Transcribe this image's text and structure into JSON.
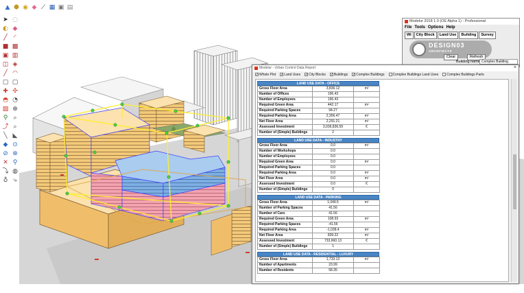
{
  "toolbar": {
    "icons": [
      "select-icon",
      "component-icon",
      "paint-bucket-icon",
      "eraser-icon",
      "tape-measure-icon",
      "section-icon",
      "warehouse-icon",
      "extension-icon"
    ]
  },
  "palette": {
    "icons": [
      "select-arrow-icon",
      "rotate-icon",
      "paint-icon",
      "eraser-icon",
      "pencil-line-icon",
      "arc-icon",
      "rectangle-icon",
      "shape-icon",
      "push-pull-icon",
      "offset-icon",
      "move-icon",
      "follow-me-icon",
      "scale-icon",
      "orbit-icon",
      "pan-icon",
      "zoom-icon",
      "walk-icon",
      "look-around-icon",
      "position-camera-icon",
      "section-plane-icon",
      "text-icon",
      "dimension-icon",
      "protractor-icon",
      "axes-icon",
      "tape-icon",
      "3d-text-icon",
      "paint-sample-icon",
      "eraser-alt-icon"
    ]
  },
  "plugin_window": {
    "title": "Modelur 2018 1.0 (OE Alpha 1) - Professional",
    "menu": [
      "File",
      "Tools",
      "Options",
      "Help"
    ],
    "tabs": [
      "Wi",
      "City Block",
      "Land Use",
      "Building",
      "Survey"
    ],
    "active_tab": "Building",
    "logo_text": "DESIGN03",
    "logo_sub": "ARCHITECTS",
    "clear_label": "Clear",
    "refresh_label": "Refresh",
    "close_label": "×",
    "building_name_label": "Building name",
    "building_name_value": "Complex Building"
  },
  "data_panel": {
    "title": "Modelur - Urban Control Data Report",
    "close_label": "×",
    "checkboxes": [
      {
        "label": "Whole Plot",
        "checked": true
      },
      {
        "label": "Land Uses",
        "checked": true
      },
      {
        "label": "City Blocks",
        "checked": true
      },
      {
        "label": "Buildings",
        "checked": true
      },
      {
        "label": "Complex Buildings",
        "checked": true
      },
      {
        "label": "Complex Buildings Land Uses",
        "checked": false
      },
      {
        "label": "Complex Buildings Parts",
        "checked": false
      }
    ],
    "sections": [
      {
        "title": "LAND USE DATA - OFFICE",
        "rows": [
          {
            "label": "Gross Floor Area",
            "value": "3,836.12",
            "unit": "m²"
          },
          {
            "label": "Number of Offices",
            "value": "196.43",
            "unit": ""
          },
          {
            "label": "Number of Employees",
            "value": "196.43",
            "unit": ""
          },
          {
            "label": "Required Green Area",
            "value": "442.17",
            "unit": "m²"
          },
          {
            "label": "Required Parking Spaces",
            "value": "94.27",
            "unit": ""
          },
          {
            "label": "Required Parking Area",
            "value": "2,356.47",
            "unit": "m²"
          },
          {
            "label": "Net Floor Area",
            "value": "2,291.21",
            "unit": "m²"
          },
          {
            "label": "Assessed Investment",
            "value": "3,036,836.59",
            "unit": "€"
          },
          {
            "label": "Number of (Simple) Buildings",
            "value": "2",
            "unit": ""
          }
        ]
      },
      {
        "title": "LAND USE DATA - INDUSTRY",
        "rows": [
          {
            "label": "Gross Floor Area",
            "value": "0.0",
            "unit": "m²"
          },
          {
            "label": "Number of Workshops",
            "value": "0.0",
            "unit": ""
          },
          {
            "label": "Number of Employees",
            "value": "0.0",
            "unit": ""
          },
          {
            "label": "Required Green Area",
            "value": "0.0",
            "unit": "m²"
          },
          {
            "label": "Required Parking Spaces",
            "value": "0.0",
            "unit": ""
          },
          {
            "label": "Required Parking Area",
            "value": "0.0",
            "unit": "m²"
          },
          {
            "label": "Net Floor Area",
            "value": "0.0",
            "unit": "m²"
          },
          {
            "label": "Assessed Investment",
            "value": "0.0",
            "unit": "€"
          },
          {
            "label": "Number of (Simple) Buildings",
            "value": "0",
            "unit": ""
          }
        ]
      },
      {
        "title": "LAND USE DATA - PARKING",
        "rows": [
          {
            "label": "Gross Floor Area",
            "value": "1,049.5",
            "unit": "m²"
          },
          {
            "label": "Number of Parking Spaces",
            "value": "41.56",
            "unit": ""
          },
          {
            "label": "Number of Cars",
            "value": "41.56",
            "unit": ""
          },
          {
            "label": "Required Green Area",
            "value": "108.93",
            "unit": "m²"
          },
          {
            "label": "Required Parking Spaces",
            "value": "-41.56",
            "unit": ""
          },
          {
            "label": "Required Parking Area",
            "value": "-1,038.4",
            "unit": "m²"
          },
          {
            "label": "Net Floor Area",
            "value": "839.22",
            "unit": "m²"
          },
          {
            "label": "Assessed Investment",
            "value": "733,660.13",
            "unit": "€"
          },
          {
            "label": "Number of (Simple) Buildings",
            "value": "1",
            "unit": ""
          }
        ]
      },
      {
        "title": "LAND USE DATA - RESIDENTIAL - LUXURY",
        "rows": [
          {
            "label": "Gross Floor Area",
            "value": "1,733.12",
            "unit": "m²"
          },
          {
            "label": "Number of Apartments",
            "value": "23.99",
            "unit": ""
          },
          {
            "label": "Number of Residents",
            "value": "58.35",
            "unit": ""
          }
        ]
      }
    ]
  },
  "colors": {
    "section_header": "#4a86c5",
    "building_tan": "#f3c97a",
    "office_blue": "#6fa6e0",
    "residential_pink": "#f19aa6",
    "selection_yellow": "#ffee2e",
    "selection_green": "#47d14a"
  }
}
